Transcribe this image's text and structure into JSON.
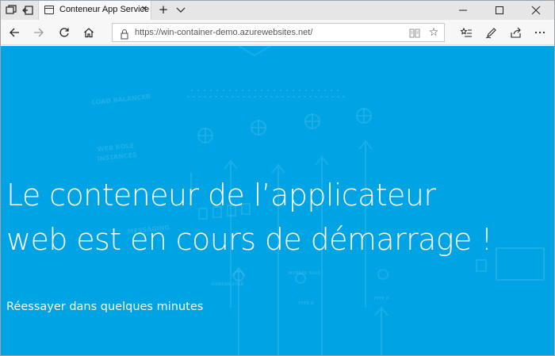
{
  "browser": {
    "tab": {
      "title": "Conteneur App Service",
      "close_icon": "close-icon"
    },
    "address": {
      "url": "https://win-container-demo.azurewebsites.net/"
    },
    "icons": {
      "tab_actions": "tab-actions-icon",
      "set_aside": "set-aside-tabs-icon",
      "new_tab": "+",
      "tab_menu": "chevron-down-icon",
      "minimize": "minimize-icon",
      "maximize": "maximize-icon",
      "close": "close-window-icon",
      "back": "back-arrow-icon",
      "forward": "forward-arrow-icon",
      "refresh": "refresh-icon",
      "home": "home-icon",
      "lock": "lock-icon",
      "reading_view": "reading-view-icon",
      "favorite": "star-icon",
      "favorites_hub": "favorites-hub-icon",
      "notes": "pen-icon",
      "share": "share-icon",
      "more": "more-icon"
    }
  },
  "page": {
    "headline_line1": "Le conteneur de l’applicateur",
    "headline_line2": "web est en cours de démarrage !",
    "subline": "Réessayer dans quelques minutes",
    "bg_labels": {
      "load_balancer": "LOAD BALANCER",
      "web_role_1": "WEB ROLE",
      "web_role_2": "INSTANCES",
      "messaging": "MESSAGING",
      "worker_role_1": "WORKER ROLE",
      "worker_role_2": "WORKER ROLE",
      "type_a": "TYPE A",
      "type_b": "TYPE B"
    },
    "colors": {
      "background": "#00a4e4",
      "text": "#ffffff"
    }
  }
}
